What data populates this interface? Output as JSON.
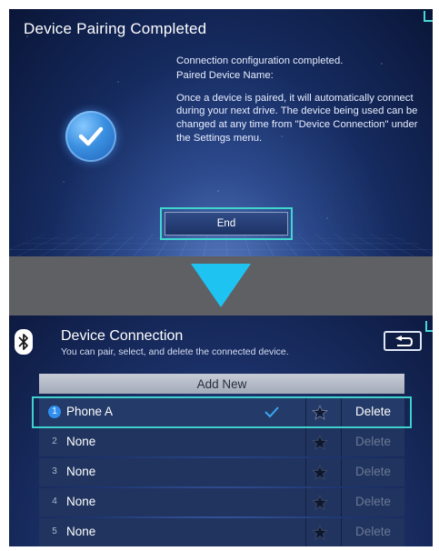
{
  "colors": {
    "accent_teal": "#40d6cf",
    "highlight_blue": "#2f8ff0",
    "band_gray": "#5f6063"
  },
  "top_screen": {
    "title": "Device Pairing Completed",
    "status_icon": "check-circle-icon",
    "message_line1": "Connection configuration completed.",
    "message_line2": "Paired Device Name:",
    "message_body": "Once a device is paired, it will automatically connect during your next drive. The device being used can be changed at any time from \"Device Connection\" under the Settings menu.",
    "end_button": "End"
  },
  "transition": {
    "arrow_icon": "down-arrow-icon"
  },
  "bottom_screen": {
    "bluetooth_icon": "bluetooth-icon",
    "title": "Device Connection",
    "subtitle": "You can pair, select, and delete the connected device.",
    "back_icon": "back-icon",
    "add_new": "Add New",
    "devices": [
      {
        "number": "1",
        "name": "Phone A",
        "selected": true,
        "delete_label": "Delete"
      },
      {
        "number": "2",
        "name": "None",
        "selected": false,
        "delete_label": "Delete"
      },
      {
        "number": "3",
        "name": "None",
        "selected": false,
        "delete_label": "Delete"
      },
      {
        "number": "4",
        "name": "None",
        "selected": false,
        "delete_label": "Delete"
      },
      {
        "number": "5",
        "name": "None",
        "selected": false,
        "delete_label": "Delete"
      }
    ]
  }
}
